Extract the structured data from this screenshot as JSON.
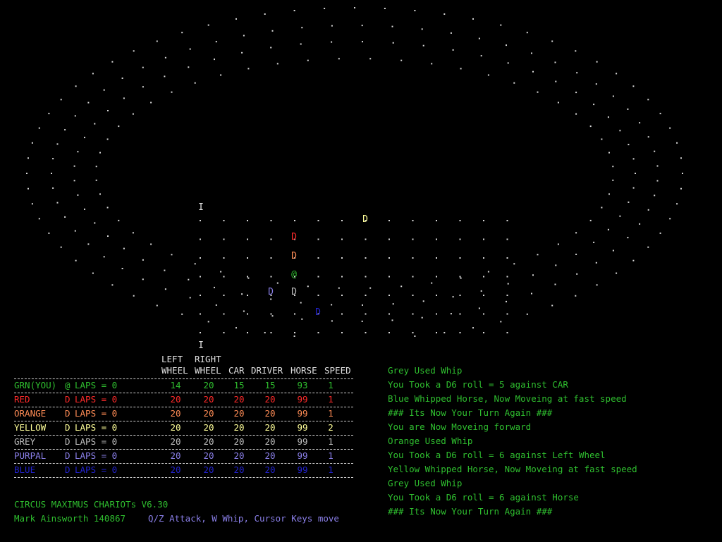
{
  "colors": {
    "background": "#000000",
    "green": "#2fbf2f",
    "red": "#ff2a2a",
    "orange": "#ff8c55",
    "yellow": "#ffff99",
    "grey": "#bdbdbd",
    "purple": "#8a7fe8",
    "blue": "#2222cc",
    "white": "#e0e0e0"
  },
  "track": {
    "player_glyph": "@",
    "opponent_glyph": "D",
    "marker_glyph": "I",
    "chariots": [
      {
        "name": "RED",
        "glyph": "D",
        "color": "#ff2a2a"
      },
      {
        "name": "ORANGE",
        "glyph": "D",
        "color": "#ff8c55"
      },
      {
        "name": "GRN(YOU)",
        "glyph": "@",
        "color": "#2fbf2f"
      },
      {
        "name": "YELLOW",
        "glyph": "D",
        "color": "#ffff99"
      },
      {
        "name": "GREY",
        "glyph": "D",
        "color": "#bdbdbd"
      },
      {
        "name": "PURPAL",
        "glyph": "D",
        "color": "#8a7fe8"
      },
      {
        "name": "BLUE",
        "glyph": "D",
        "color": "#2222cc"
      }
    ]
  },
  "table": {
    "header_top": {
      "left": "LEFT",
      "right": "RIGHT"
    },
    "header_bottom": {
      "left": "WHEEL",
      "right": "WHEEL",
      "car": "CAR",
      "driver": "DRIVER",
      "horse": "HORSE",
      "speed": "SPEED"
    },
    "rows": [
      {
        "name": "GRN(YOU)",
        "glyph": "@",
        "laps_label": "LAPS = 0",
        "left": "14",
        "right": "20",
        "car": "15",
        "driver": "15",
        "horse": "93",
        "speed": "1",
        "color": "#2fbf2f"
      },
      {
        "name": "RED",
        "glyph": "D",
        "laps_label": "LAPS = 0",
        "left": "20",
        "right": "20",
        "car": "20",
        "driver": "20",
        "horse": "99",
        "speed": "1",
        "color": "#ff2a2a"
      },
      {
        "name": "ORANGE",
        "glyph": "D",
        "laps_label": "LAPS = 0",
        "left": "20",
        "right": "20",
        "car": "20",
        "driver": "20",
        "horse": "99",
        "speed": "1",
        "color": "#ff8c55"
      },
      {
        "name": "YELLOW",
        "glyph": "D",
        "laps_label": "LAPS = 0",
        "left": "20",
        "right": "20",
        "car": "20",
        "driver": "20",
        "horse": "99",
        "speed": "2",
        "color": "#ffff99"
      },
      {
        "name": "GREY",
        "glyph": "D",
        "laps_label": "LAPS = 0",
        "left": "20",
        "right": "20",
        "car": "20",
        "driver": "20",
        "horse": "99",
        "speed": "1",
        "color": "#bdbdbd"
      },
      {
        "name": "PURPAL",
        "glyph": "D",
        "laps_label": "LAPS = 0",
        "left": "20",
        "right": "20",
        "car": "20",
        "driver": "20",
        "horse": "99",
        "speed": "1",
        "color": "#8a7fe8"
      },
      {
        "name": "BLUE",
        "glyph": "D",
        "laps_label": "LAPS = 0",
        "left": "20",
        "right": "20",
        "car": "20",
        "driver": "20",
        "horse": "99",
        "speed": "1",
        "color": "#2222cc"
      }
    ]
  },
  "footer": {
    "title": "CIRCUS MAXIMUS CHARIOTs V6.30",
    "author": "Mark Ainsworth 140867",
    "controls": "Q/Z Attack, W Whip, Cursor Keys move"
  },
  "log": [
    "Grey Used Whip",
    "You Took a D6 roll = 5 against CAR",
    "Blue Whipped Horse, Now Moveing at fast speed",
    "### Its Now Your Turn Again ###",
    "You are Now Moveing forward",
    "Orange Used Whip",
    "You Took a D6 roll = 6 against Left Wheel",
    "Yellow Whipped Horse, Now Moveing at fast speed",
    "Grey Used Whip",
    "You Took a D6 roll = 6 against Horse",
    "### Its Now Your Turn Again ###"
  ]
}
